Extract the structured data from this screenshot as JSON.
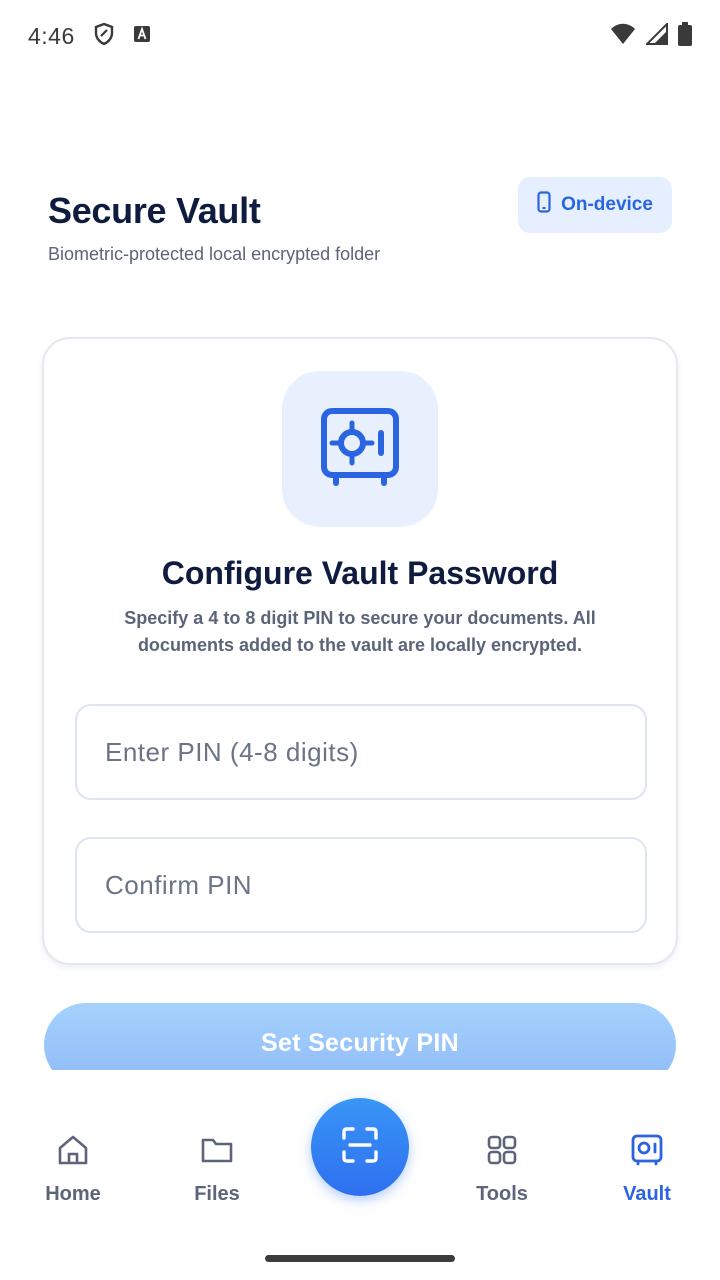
{
  "status_bar": {
    "time": "4:46",
    "icons": [
      "shield-icon",
      "keyboard-a-icon",
      "wifi-icon",
      "signal-icon",
      "battery-icon"
    ]
  },
  "header": {
    "title": "Secure Vault",
    "subtitle": "Biometric-protected local encrypted folder",
    "badge_label": "On-device",
    "badge_icon": "phone-icon"
  },
  "card": {
    "icon": "vault-safe-icon",
    "title": "Configure Vault Password",
    "description": "Specify a 4 to 8 digit PIN to secure your documents. All documents added to the vault are locally encrypted.",
    "pin_field": {
      "placeholder": "Enter PIN (4-8 digits)",
      "value": ""
    },
    "confirm_field": {
      "placeholder": "Confirm PIN",
      "value": ""
    }
  },
  "primary_action": {
    "label": "Set Security PIN"
  },
  "bottom_nav": {
    "items": [
      {
        "label": "Home",
        "icon": "home-icon",
        "active": false
      },
      {
        "label": "Files",
        "icon": "folder-icon",
        "active": false
      },
      {
        "label": "Tools",
        "icon": "grid-icon",
        "active": false
      },
      {
        "label": "Vault",
        "icon": "vault-icon",
        "active": true
      }
    ],
    "fab_icon": "scan-icon"
  },
  "colors": {
    "accent": "#2a64e0",
    "title": "#0f1c3f",
    "muted": "#5b6478",
    "icon_bg": "#e8f0fe",
    "button_disabled": "#a5d2fc"
  }
}
